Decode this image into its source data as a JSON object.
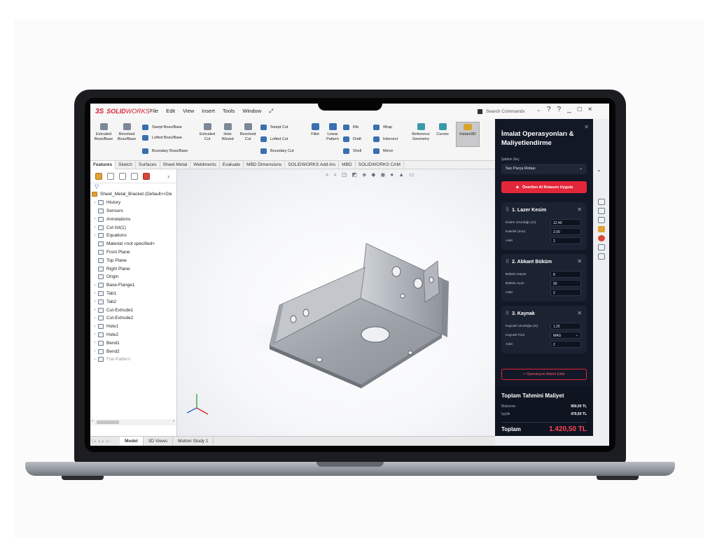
{
  "app": {
    "brand_prefix": "3S",
    "brand_bold": "SOLID",
    "brand_light": "WORKS",
    "menus": [
      "File",
      "Edit",
      "View",
      "Insert",
      "Tools",
      "Window"
    ],
    "search_placeholder": "Search Commands",
    "window_controls": [
      "?",
      "?",
      "_",
      "□",
      "×"
    ]
  },
  "ribbon": {
    "extruded_boss": "Extruded Boss/Base",
    "revolved_boss": "Revolved Boss/Base",
    "swept_boss": "Swept Boss/Base",
    "lofted_boss": "Lofted Boss/Base",
    "boundary_boss": "Boundary Boss/Base",
    "extruded_cut": "Extruded Cut",
    "hole_wizard": "Hole Wizard",
    "revolved_cut": "Revolved Cut",
    "swept_cut": "Swept Cut",
    "lofted_cut": "Lofted Cut",
    "boundary_cut": "Boundary Cut",
    "fillet": "Fillet",
    "linear_pattern": "Linear Pattern",
    "rib": "Rib",
    "draft": "Draft",
    "shell": "Shell",
    "wrap": "Wrap",
    "intersect": "Intersect",
    "mirror": "Mirror",
    "reference_geometry": "Reference Geometry",
    "curves": "Curves",
    "instant3d": "Instant3D"
  },
  "command_tabs": [
    "Features",
    "Sketch",
    "Surfaces",
    "Sheet Metal",
    "Weldments",
    "Evaluate",
    "MBD Dimensions",
    "SOLIDWORKS Add-Ins",
    "MBD",
    "SOLIDWORKS CAM"
  ],
  "tree": {
    "root": "Sheet_Metal_Bracket (Default<<De",
    "items": [
      {
        "label": "History",
        "expandable": true
      },
      {
        "label": "Sensors",
        "expandable": false
      },
      {
        "label": "Annotations",
        "expandable": true
      },
      {
        "label": "Cut list(1)",
        "expandable": true
      },
      {
        "label": "Equations",
        "expandable": true
      },
      {
        "label": "Material <not specified>",
        "expandable": false
      },
      {
        "label": "Front Plane",
        "expandable": false
      },
      {
        "label": "Top Plane",
        "expandable": false
      },
      {
        "label": "Right Plane",
        "expandable": false
      },
      {
        "label": "Origin",
        "expandable": false
      },
      {
        "label": "Base-Flange1",
        "expandable": true
      },
      {
        "label": "Tab1",
        "expandable": true
      },
      {
        "label": "Tab2",
        "expandable": true
      },
      {
        "label": "Cut-Extrude1",
        "expandable": true
      },
      {
        "label": "Cut-Extrude2",
        "expandable": true
      },
      {
        "label": "Hole1",
        "expandable": true
      },
      {
        "label": "Hole2",
        "expandable": true
      },
      {
        "label": "Bend1",
        "expandable": true
      },
      {
        "label": "Bend2",
        "expandable": true
      },
      {
        "label": "Flat-Pattern",
        "expandable": true
      }
    ]
  },
  "bottom_tabs": [
    "Model",
    "3D Views",
    "Motion Study 1"
  ],
  "panel": {
    "title": "İmalat Operasyonları & Maliyetlendirme",
    "template_label": "Şablon Seç",
    "template_value": "Sac Parça Rotası",
    "apply_button": "Önerilen AI Rotasını Uygula",
    "operations": [
      {
        "title": "1. Lazer Kesim",
        "fields": [
          {
            "label": "Kesim Uzunluğu (m)",
            "value": "12.40"
          },
          {
            "label": "Kalınlık (mm)",
            "value": "2.00"
          },
          {
            "label": "Adet",
            "value": "2"
          }
        ]
      },
      {
        "title": "2. Abkant Büküm",
        "fields": [
          {
            "label": "Büküm Sayısı",
            "value": "8"
          },
          {
            "label": "Büküm Açısı",
            "value": "90"
          },
          {
            "label": "Adet",
            "value": "2"
          }
        ]
      },
      {
        "title": "3. Kaynak",
        "fields": [
          {
            "label": "Kaynak Uzunluğu (m)",
            "value": "1.25"
          },
          {
            "label": "Kaynak Türü",
            "value": "MAG"
          },
          {
            "label": "Adet",
            "value": "2"
          }
        ]
      }
    ],
    "add_step": "+ Operasyon Adımı Ekle",
    "cost_title": "Toplam Tahmini Maliyet",
    "material_label": "Malzeme",
    "material_value": "950,00 TL",
    "labor_label": "İşçilik",
    "labor_value": "470,50 TL",
    "total_label": "Toplam",
    "total_value": "1.420,50 TL"
  },
  "colors": {
    "accent_red": "#e3263a",
    "panel_bg": "#121826",
    "brand_red": "#d6202f"
  }
}
